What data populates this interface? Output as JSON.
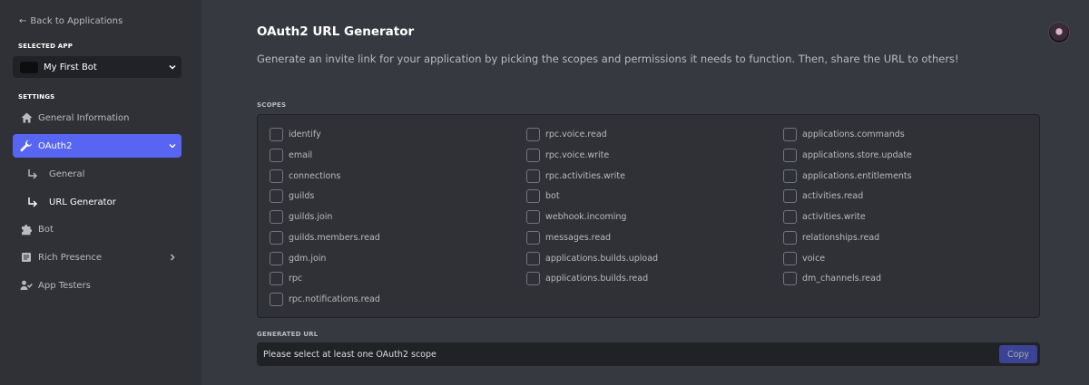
{
  "sidebar": {
    "back_label": "Back to Applications",
    "selected_app_label": "SELECTED APP",
    "app_name": "My First Bot",
    "settings_label": "SETTINGS",
    "items": [
      {
        "label": "General Information"
      },
      {
        "label": "OAuth2"
      },
      {
        "label": "Bot"
      },
      {
        "label": "Rich Presence"
      },
      {
        "label": "App Testers"
      }
    ],
    "sub_items": [
      {
        "label": "General"
      },
      {
        "label": "URL Generator"
      }
    ]
  },
  "main": {
    "title": "OAuth2 URL Generator",
    "subtitle": "Generate an invite link for your application by picking the scopes and permissions it needs to function. Then, share the URL to others!",
    "scopes_label": "SCOPES",
    "scopes": [
      [
        "identify",
        "email",
        "connections",
        "guilds",
        "guilds.join",
        "guilds.members.read",
        "gdm.join",
        "rpc",
        "rpc.notifications.read"
      ],
      [
        "rpc.voice.read",
        "rpc.voice.write",
        "rpc.activities.write",
        "bot",
        "webhook.incoming",
        "messages.read",
        "applications.builds.upload",
        "applications.builds.read"
      ],
      [
        "applications.commands",
        "applications.store.update",
        "applications.entitlements",
        "activities.read",
        "activities.write",
        "relationships.read",
        "voice",
        "dm_channels.read"
      ]
    ],
    "generated_url_label": "GENERATED URL",
    "generated_url_placeholder": "Please select at least one OAuth2 scope",
    "copy_label": "Copy"
  },
  "colors": {
    "accent": "#5865f2",
    "sidebar_bg": "#2f3136",
    "main_bg": "#36393f"
  }
}
